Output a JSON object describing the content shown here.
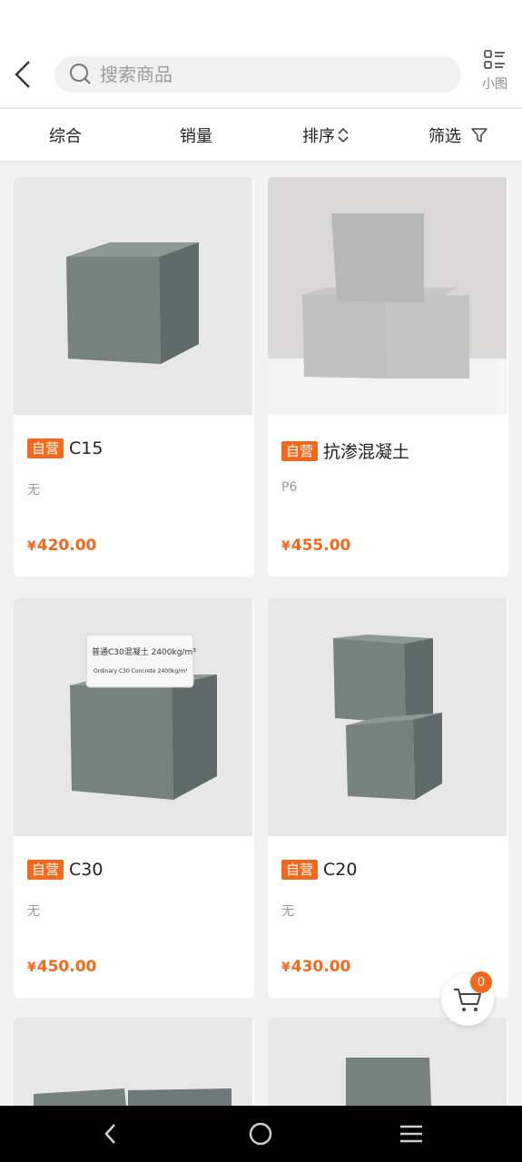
{
  "search": {
    "placeholder": "搜索商品"
  },
  "layout_toggle": {
    "label": "小图"
  },
  "sortbar": {
    "items": [
      {
        "label": "综合"
      },
      {
        "label": "销量"
      },
      {
        "label": "排序"
      },
      {
        "label": "筛选"
      }
    ]
  },
  "products": [
    {
      "tag": "自营",
      "name": "C15",
      "spec": "无",
      "currency": "¥",
      "price": "420.00"
    },
    {
      "tag": "自营",
      "name": "抗渗混凝土",
      "spec": "P6",
      "currency": "¥",
      "price": "455.00"
    },
    {
      "tag": "自营",
      "name": "C30",
      "spec": "无",
      "currency": "¥",
      "price": "450.00"
    },
    {
      "tag": "自营",
      "name": "C20",
      "spec": "无",
      "currency": "¥",
      "price": "430.00"
    }
  ],
  "product3_label": {
    "line1": "普通C30混凝土 2400kg/m³",
    "line2": "Ordinary C30 Concrete 2400kg/m³"
  },
  "cart": {
    "count": "0"
  },
  "colors": {
    "accent": "#f2691e",
    "background": "#f2f2f2"
  },
  "icons": [
    "back-icon",
    "search-icon",
    "list-view-icon",
    "sort-chevrons-icon",
    "filter-icon",
    "cart-icon",
    "nav-back-icon",
    "nav-home-icon",
    "nav-menu-icon"
  ]
}
